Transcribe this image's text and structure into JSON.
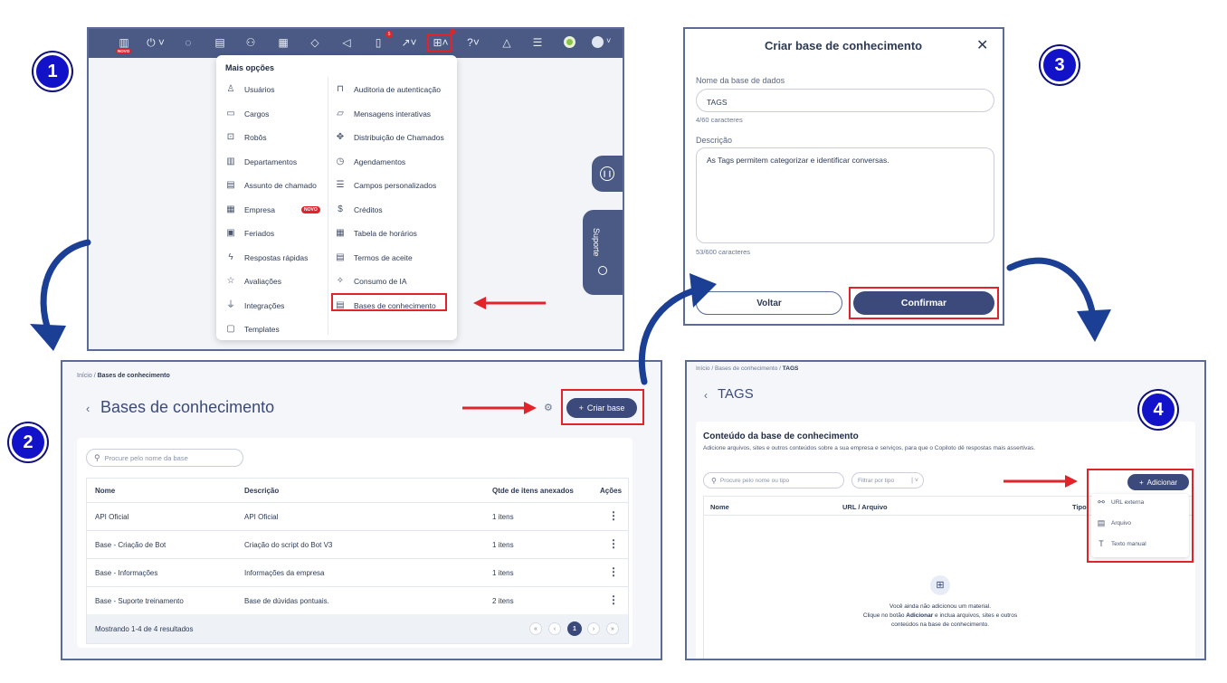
{
  "steps": [
    "1",
    "2",
    "3",
    "4"
  ],
  "panel1": {
    "topbar_badge_new": "NOVO",
    "topbar_badge_count": "5",
    "menu_title": "Mais opções",
    "left_items": [
      {
        "label": "Usuários",
        "icon": "user-icon"
      },
      {
        "label": "Cargos",
        "icon": "briefcase-icon"
      },
      {
        "label": "Robôs",
        "icon": "robot-icon"
      },
      {
        "label": "Departamentos",
        "icon": "building-icon"
      },
      {
        "label": "Assunto de chamado",
        "icon": "archive-icon"
      },
      {
        "label": "Empresa",
        "icon": "company-icon",
        "badge": "NOVO"
      },
      {
        "label": "Feriados",
        "icon": "calendar-icon"
      },
      {
        "label": "Respostas rápidas",
        "icon": "lightning-icon"
      },
      {
        "label": "Avaliações",
        "icon": "star-icon"
      },
      {
        "label": "Integrações",
        "icon": "plug-icon"
      },
      {
        "label": "Templates",
        "icon": "template-icon"
      }
    ],
    "right_items": [
      {
        "label": "Auditoria de autenticação",
        "icon": "lock-icon"
      },
      {
        "label": "Mensagens interativas",
        "icon": "chat-icon"
      },
      {
        "label": "Distribuição de Chamados",
        "icon": "move-icon"
      },
      {
        "label": "Agendamentos",
        "icon": "clock-icon"
      },
      {
        "label": "Campos personalizados",
        "icon": "list-icon"
      },
      {
        "label": "Créditos",
        "icon": "dollar-icon"
      },
      {
        "label": "Tabela de horários",
        "icon": "table-icon"
      },
      {
        "label": "Termos de aceite",
        "icon": "document-icon"
      },
      {
        "label": "Consumo de IA",
        "icon": "magic-icon"
      },
      {
        "label": "Bases de conhecimento",
        "icon": "database-icon"
      }
    ],
    "suporte": "Suporte"
  },
  "panel2": {
    "breadcrumb_home": "Início",
    "breadcrumb_sep": "/",
    "breadcrumb_current": "Bases de conhecimento",
    "title": "Bases de conhecimento",
    "create_button": "Criar base",
    "search_placeholder": "Procure pelo nome da base",
    "columns": [
      "Nome",
      "Descrição",
      "Qtde de itens anexados",
      "Ações"
    ],
    "rows": [
      [
        "API Oficial",
        "API Oficial",
        "1 itens"
      ],
      [
        "Base - Criação de Bot",
        "Criação do script do Bot V3",
        "1 itens"
      ],
      [
        "Base - Informações",
        "Informações da empresa",
        "1 itens"
      ],
      [
        "Base - Suporte treinamento",
        "Base de dúvidas pontuais.",
        "2 itens"
      ]
    ],
    "footer": "Mostrando 1-4 de 4 resultados",
    "current_page": "1"
  },
  "panel3": {
    "title": "Criar base de conhecimento",
    "name_label": "Nome da base de dados",
    "name_value": "TAGS",
    "name_counter": "4/60 caracteres",
    "desc_label": "Descrição",
    "desc_value": "As Tags permitem categorizar e identificar conversas.",
    "desc_counter": "53/600 caracteres",
    "back_button": "Voltar",
    "confirm_button": "Confirmar"
  },
  "panel4": {
    "breadcrumb": "Início / Bases de conhecimento / TAGS",
    "breadcrumb_home": "Início / Bases de conhecimento /",
    "breadcrumb_current": "TAGS",
    "title": "TAGS",
    "section_title": "Conteúdo da base de conhecimento",
    "section_desc": "Adicione arquivos, sites e outros conteúdos sobre a sua empresa e serviços, para que o Copiloto dê respostas mais assertivas.",
    "search_placeholder": "Procure pelo nome ou tipo",
    "filter_placeholder": "Filtrar por tipo",
    "add_button": "Adicionar",
    "columns": [
      "Nome",
      "URL / Arquivo",
      "Tipo"
    ],
    "dropdown": [
      {
        "label": "URL externa",
        "icon": "link-icon"
      },
      {
        "label": "Arquivo",
        "icon": "file-icon"
      },
      {
        "label": "Texto manual",
        "icon": "text-icon"
      }
    ],
    "empty_line1": "Você ainda não adicionou um material.",
    "empty_line2_a": "Clique no botão ",
    "empty_line2_b": "Adicionar",
    "empty_line2_c": " e inclua arquivos, sites e outros",
    "empty_line3": "conteúdos na base de conhecimento."
  },
  "colors": {
    "navy": "#3b4a7a",
    "red": "#e3232a",
    "step_blue": "#1212c8",
    "arrow_blue": "#1a3f95"
  }
}
